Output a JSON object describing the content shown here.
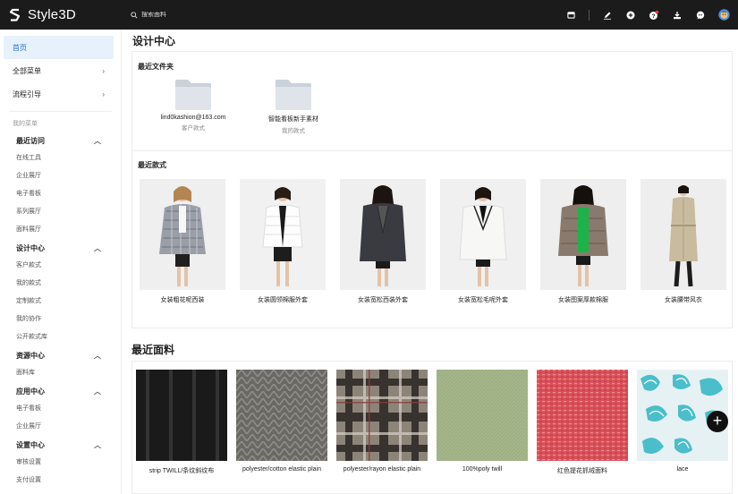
{
  "app": {
    "logo_text": "Style3D"
  },
  "search": {
    "placeholder": "搜索面料"
  },
  "sidebar": {
    "top_items": [
      {
        "label": "首页"
      },
      {
        "label": "全部菜单"
      },
      {
        "label": "流程引导"
      }
    ],
    "my_menu_label": "我的菜单",
    "groups": [
      {
        "label": "最近访问",
        "items": [
          "在线工具",
          "企业展厅",
          "电子看板",
          "系列展厅",
          "面料展厅"
        ]
      },
      {
        "label": "设计中心",
        "items": [
          "客户款式",
          "我的款式",
          "定制款式",
          "我的协作",
          "公开款式库"
        ]
      },
      {
        "label": "资源中心",
        "items": [
          "面料库"
        ]
      },
      {
        "label": "应用中心",
        "items": [
          "电子看板",
          "企业展厅"
        ]
      },
      {
        "label": "设置中心",
        "items": [
          "审核设置",
          "支付设置"
        ]
      }
    ]
  },
  "main": {
    "page_title": "设计中心",
    "recent_folders": {
      "title": "最近文件夹",
      "items": [
        {
          "name": "lind0kashion@163.com",
          "sub": "客户款式"
        },
        {
          "name": "智能看板新手素材",
          "sub": "我的款式"
        }
      ]
    },
    "recent_styles": {
      "title": "最近款式",
      "items": [
        {
          "name": "女装粗花呢西装"
        },
        {
          "name": "女装圆领棉服外套"
        },
        {
          "name": "女装宽松西装外套"
        },
        {
          "name": "女装宽松毛呢外套"
        },
        {
          "name": "女装图案厚款棉服"
        },
        {
          "name": "女装腰带风衣"
        }
      ]
    },
    "recent_fabrics": {
      "title": "最近面料",
      "items": [
        {
          "name": "strip TWILL/条纹斜纹布"
        },
        {
          "name": "polyester/cotton elastic plain"
        },
        {
          "name": "polyester/rayon elastic plain"
        },
        {
          "name": "100%poly twill"
        },
        {
          "name": "红色提花抓绒面料"
        },
        {
          "name": "lace"
        }
      ]
    },
    "fab_button": "+"
  },
  "colors": {
    "accent": "#2870d9",
    "topbar": "#1b1b1b",
    "active_bg": "#e6f1fb"
  }
}
